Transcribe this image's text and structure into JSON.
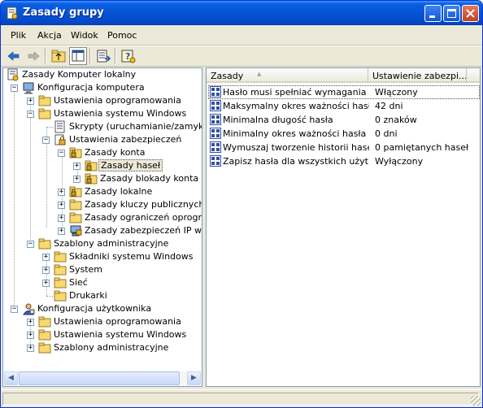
{
  "window": {
    "title": "Zasady grupy",
    "controls": {
      "minimize": "_",
      "maximize": "□",
      "close": "✕"
    }
  },
  "menu": [
    "Plik",
    "Akcja",
    "Widok",
    "Pomoc"
  ],
  "toolbar": [
    "back-arrow-icon",
    "forward-arrow-icon",
    "up-folder-icon",
    "show-hide-tree-icon",
    "export-list-icon",
    "help-icon"
  ],
  "tree": [
    {
      "label": "Zasady Komputer lokalny",
      "icon": "policy-computer-icon"
    },
    {
      "label": "Konfiguracja komputera",
      "icon": "computer-icon"
    },
    {
      "label": "Ustawienia oprogramowania",
      "icon": "folder-icon"
    },
    {
      "label": "Ustawienia systemu Windows",
      "icon": "folder-icon"
    },
    {
      "label": "Skrypty (uruchamianie/zamykanie)",
      "icon": "script-icon"
    },
    {
      "label": "Ustawienia zabezpieczeń",
      "icon": "security-icon"
    },
    {
      "label": "Zasady konta",
      "icon": "folder-lock-icon"
    },
    {
      "label": "Zasady haseł",
      "icon": "folder-lock-icon"
    },
    {
      "label": "Zasady blokady konta",
      "icon": "folder-lock-icon"
    },
    {
      "label": "Zasady lokalne",
      "icon": "folder-lock-icon"
    },
    {
      "label": "Zasady kluczy publicznych",
      "icon": "folder-icon"
    },
    {
      "label": "Zasady ograniczeń oprogramowania",
      "icon": "folder-icon"
    },
    {
      "label": "Zasady zabezpieczeń IP w Komputer lokalny",
      "icon": "ip-security-icon"
    },
    {
      "label": "Szablony administracyjne",
      "icon": "folder-icon"
    },
    {
      "label": "Składniki systemu Windows",
      "icon": "folder-icon"
    },
    {
      "label": "System",
      "icon": "folder-icon"
    },
    {
      "label": "Sieć",
      "icon": "folder-icon"
    },
    {
      "label": "Drukarki",
      "icon": "folder-icon"
    },
    {
      "label": "Konfiguracja użytkownika",
      "icon": "user-icon"
    },
    {
      "label": "Ustawienia oprogramowania",
      "icon": "folder-icon"
    },
    {
      "label": "Ustawienia systemu Windows",
      "icon": "folder-icon"
    },
    {
      "label": "Szablony administracyjne",
      "icon": "folder-icon"
    }
  ],
  "list": {
    "columns": [
      "Zasady",
      "Ustawienie zabezpi..."
    ],
    "sort_indicator": "▲",
    "rows": [
      {
        "name": "Hasło musi spełniać wymagania co...",
        "value": "Włączony"
      },
      {
        "name": "Maksymalny okres ważności hasła",
        "value": "42 dni"
      },
      {
        "name": "Minimalna długość hasła",
        "value": "0 znaków"
      },
      {
        "name": "Minimalny okres ważności hasła",
        "value": "0 dni"
      },
      {
        "name": "Wymuszaj tworzenie historii haseł",
        "value": "0 pamiętanych haseł"
      },
      {
        "name": "Zapisz hasła dla wszystkich użytko...",
        "value": "Wyłączony"
      }
    ]
  }
}
